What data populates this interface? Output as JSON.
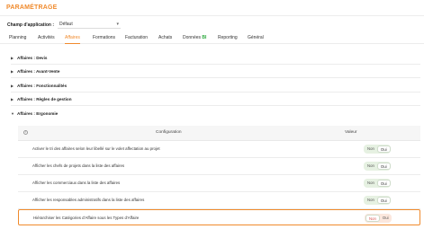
{
  "page": {
    "title": "PARAMÉTRAGE"
  },
  "app_select": {
    "label": "Champ d'application :",
    "value": "Défaut"
  },
  "tabs": [
    {
      "label": "Planning",
      "active": false
    },
    {
      "label": "Activités",
      "active": false
    },
    {
      "label": "Affaires",
      "active": true
    },
    {
      "label": "Formations",
      "active": false
    },
    {
      "label": "Facturation",
      "active": false
    },
    {
      "label": "Achats",
      "active": false
    },
    {
      "label": "Données",
      "badge": "BI",
      "active": false
    },
    {
      "label": "Reporting",
      "active": false
    },
    {
      "label": "Général",
      "active": false
    }
  ],
  "sections": [
    {
      "label": "Affaires : Devis",
      "expanded": false
    },
    {
      "label": "Affaires : Avant-Vente",
      "expanded": false
    },
    {
      "label": "Affaires : Fonctionnalités",
      "expanded": false
    },
    {
      "label": "Affaires : Règles de gestion",
      "expanded": false
    },
    {
      "label": "Affaires : Ergonomie",
      "expanded": true
    }
  ],
  "table": {
    "info_icon": "i",
    "col_config": "Configuration",
    "col_value": "Valeur",
    "rows": [
      {
        "text": "Activer le tri des affaires selon leur libellé sur le volet affectation au projet",
        "no": "Non",
        "yes": "Oui",
        "selected": "Oui"
      },
      {
        "text": "Afficher les chefs de projets dans la liste des affaires",
        "no": "Non",
        "yes": "Oui",
        "selected": "Oui"
      },
      {
        "text": "Afficher les commerciaux dans la liste des affaires",
        "no": "Non",
        "yes": "Oui",
        "selected": "Oui"
      },
      {
        "text": "Afficher les responsables administratifs dans la liste des affaires",
        "no": "Non",
        "yes": "Oui",
        "selected": "Oui"
      },
      {
        "text": "Hiérarchiser les Catégories d'Affaire sous les Types d'Affaire",
        "no": "Non",
        "yes": "Oui",
        "selected": "Non",
        "highlighted": true
      }
    ]
  },
  "colors": {
    "accent": "#f08a2c",
    "toggle_green": "#e6f1e2",
    "toggle_red": "#fbe7dd",
    "badge_green": "#2eaa3f"
  },
  "icons": {
    "collapsed": "caret-right-icon",
    "expanded": "caret-down-icon",
    "select": "chevron-down-icon",
    "info": "info-icon"
  }
}
